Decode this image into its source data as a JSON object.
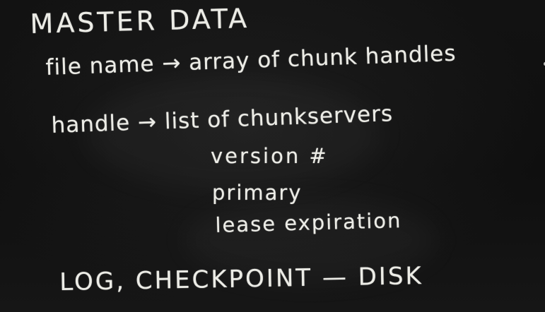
{
  "board": {
    "title": "MASTER  DATA",
    "line1": "file name → array of chunk handles",
    "line2": "handle → list of chunkservers",
    "sub_items": [
      "version #",
      "primary",
      "lease expiration"
    ],
    "bottom": "LOG, CHECKPOINT — DISK"
  },
  "colors": {
    "chalk": "#ecece6",
    "board": "#121212"
  }
}
